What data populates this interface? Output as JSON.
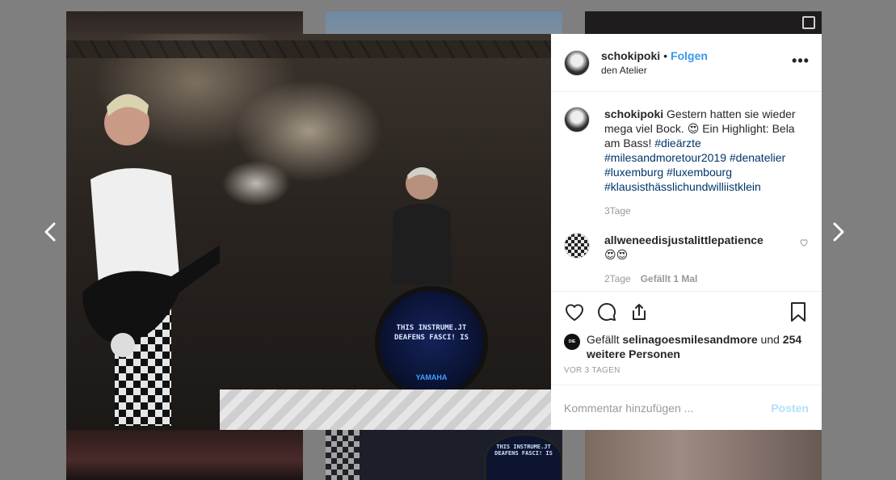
{
  "post": {
    "username": "schokipoki",
    "separator": "•",
    "follow_label": "Folgen",
    "location": "den Atelier",
    "more_icon": "more-horizontal-icon",
    "more_glyph": "•••"
  },
  "caption": {
    "username": "schokipoki",
    "text_before": "Gestern hatten sie wieder mega viel Bock. 😍 Ein Highlight: Bela am Bass!",
    "hashtags": [
      "#dieärzte",
      "#milesandmoretour2019",
      "#denatelier",
      "#luxemburg",
      "#luxembourg",
      "#klausisthässlichundwilliistklein"
    ],
    "time": "3Tage"
  },
  "comments": [
    {
      "username": "allweneedisjustalittlepatience",
      "text": "😍😍",
      "time": "2Tage",
      "likes": "Gefällt 1 Mal"
    }
  ],
  "likes_summary": {
    "prefix": "Gefällt",
    "user": "selinagoesmilesandmore",
    "connector": "und",
    "others": "254 weitere Personen",
    "mini_avatar_text": "DIE ÄRZTE"
  },
  "posted": "VOR 3 TAGEN",
  "comment_box": {
    "placeholder": "Kommentar hinzufügen ...",
    "post_label": "Posten"
  },
  "photo": {
    "kick_text_line1": "THIS INSTRUME.JT",
    "kick_text_line2": "DEAFENS FASCI! IS",
    "kick_brand": "YAMAHA"
  },
  "thumb": {
    "drum_text": "THIS INSTRUME.JT DEAFENS FASCI! IS"
  },
  "colors": {
    "accent": "#3897f0",
    "hashtag": "#003569",
    "post_disabled": "#b2dffc",
    "overlay": "#7f7f7f"
  }
}
